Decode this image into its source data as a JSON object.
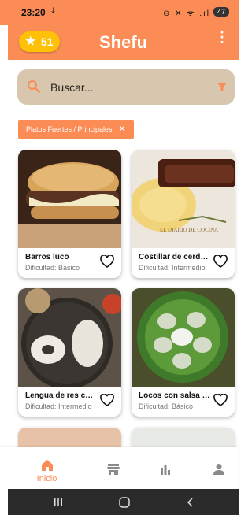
{
  "status_bar": {
    "time": "23:20",
    "download_glyph": "⤓",
    "battery": "47",
    "icons": "⊖ ✕ ᯤ .ıl"
  },
  "app_bar": {
    "title": "Shefu",
    "coins": "51",
    "menu_glyph": "⋮"
  },
  "search": {
    "placeholder": "Buscar..."
  },
  "filter_chip": {
    "label": "Platos Fuertes / Principales",
    "close": "✕"
  },
  "recipes": [
    {
      "name": "Barros luco",
      "difficulty": "Dificultad: Básico"
    },
    {
      "name": "Costillar de cerdo al horno",
      "difficulty": "Dificultad: Intermedio"
    },
    {
      "name": "Lengua de res con salsa",
      "difficulty": "Dificultad: Intermedio"
    },
    {
      "name": "Locos con salsa verde",
      "difficulty": "Dificultad: Básico"
    }
  ],
  "watermark": "EL DIARIO DE COCINA",
  "bottom_nav": [
    {
      "label": "Inicio",
      "icon": "home-icon",
      "active": true
    },
    {
      "label": "",
      "icon": "store-icon"
    },
    {
      "label": "",
      "icon": "bar-chart-icon"
    },
    {
      "label": "",
      "icon": "person-icon"
    }
  ],
  "colors": {
    "primary": "#FB8C56",
    "coin": "#FFC107",
    "search_bg": "#D8C6AE",
    "icon_gray": "#8A8A8A"
  }
}
